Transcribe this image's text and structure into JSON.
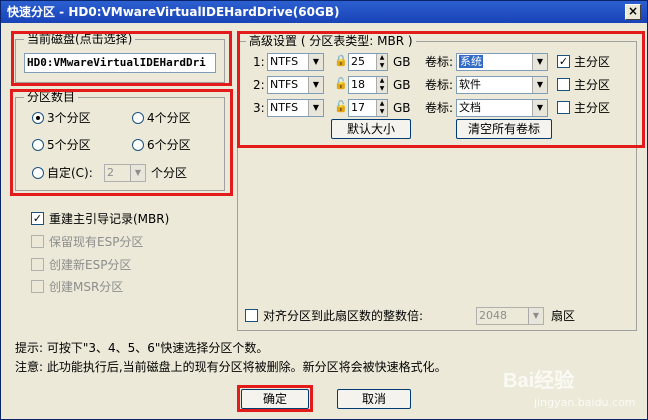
{
  "window": {
    "title": "快速分区 - HD0:VMwareVirtualIDEHardDrive(60GB)",
    "close_glyph": "×"
  },
  "disk_group": {
    "title": "当前磁盘(点击选择)",
    "disk_name": "HD0:VMwareVirtualIDEHardDri"
  },
  "count_group": {
    "title": "分区数目",
    "options": [
      {
        "label": "3个分区",
        "checked": true
      },
      {
        "label": "4个分区",
        "checked": false
      },
      {
        "label": "5个分区",
        "checked": false
      },
      {
        "label": "6个分区",
        "checked": false
      }
    ],
    "custom_label": "自定(C):",
    "custom_value": "2",
    "custom_suffix": "个分区"
  },
  "options": {
    "mbr_label": "重建主引导记录(MBR)",
    "mbr_checked": true,
    "esp_keep_label": "保留现有ESP分区",
    "esp_new_label": "创建新ESP分区",
    "msr_label": "创建MSR分区"
  },
  "advanced": {
    "title": "高级设置 ( 分区表类型: MBR )",
    "rows": [
      {
        "index": "1:",
        "fs": "NTFS",
        "size": "25",
        "unit": "GB",
        "label_text": "卷标:",
        "volume": "系统",
        "primary_label": "主分区",
        "primary": true
      },
      {
        "index": "2:",
        "fs": "NTFS",
        "size": "18",
        "unit": "GB",
        "label_text": "卷标:",
        "volume": "软件",
        "primary_label": "主分区",
        "primary": false
      },
      {
        "index": "3:",
        "fs": "NTFS",
        "size": "17",
        "unit": "GB",
        "label_text": "卷标:",
        "volume": "文档",
        "primary_label": "主分区",
        "primary": false
      }
    ],
    "default_size_button": "默认大小",
    "clear_labels_button": "清空所有卷标"
  },
  "align": {
    "label": "对齐分区到此扇区数的整数倍:",
    "value": "2048",
    "unit": "扇区"
  },
  "hints": {
    "tip": "提示: 可按下\"3、4、5、6\"快速选择分区个数。",
    "warning": "注意: 此功能执行后,当前磁盘上的现有分区将被删除。新分区将会被快速格式化。"
  },
  "buttons": {
    "ok": "确定",
    "cancel": "取消"
  },
  "watermark": {
    "brand": "Bai经验",
    "url": "jingyan.baidu.com"
  },
  "colors": {
    "highlight": "#e31b1b",
    "titlebar": "#1943b8",
    "selection": "#316ac5"
  }
}
